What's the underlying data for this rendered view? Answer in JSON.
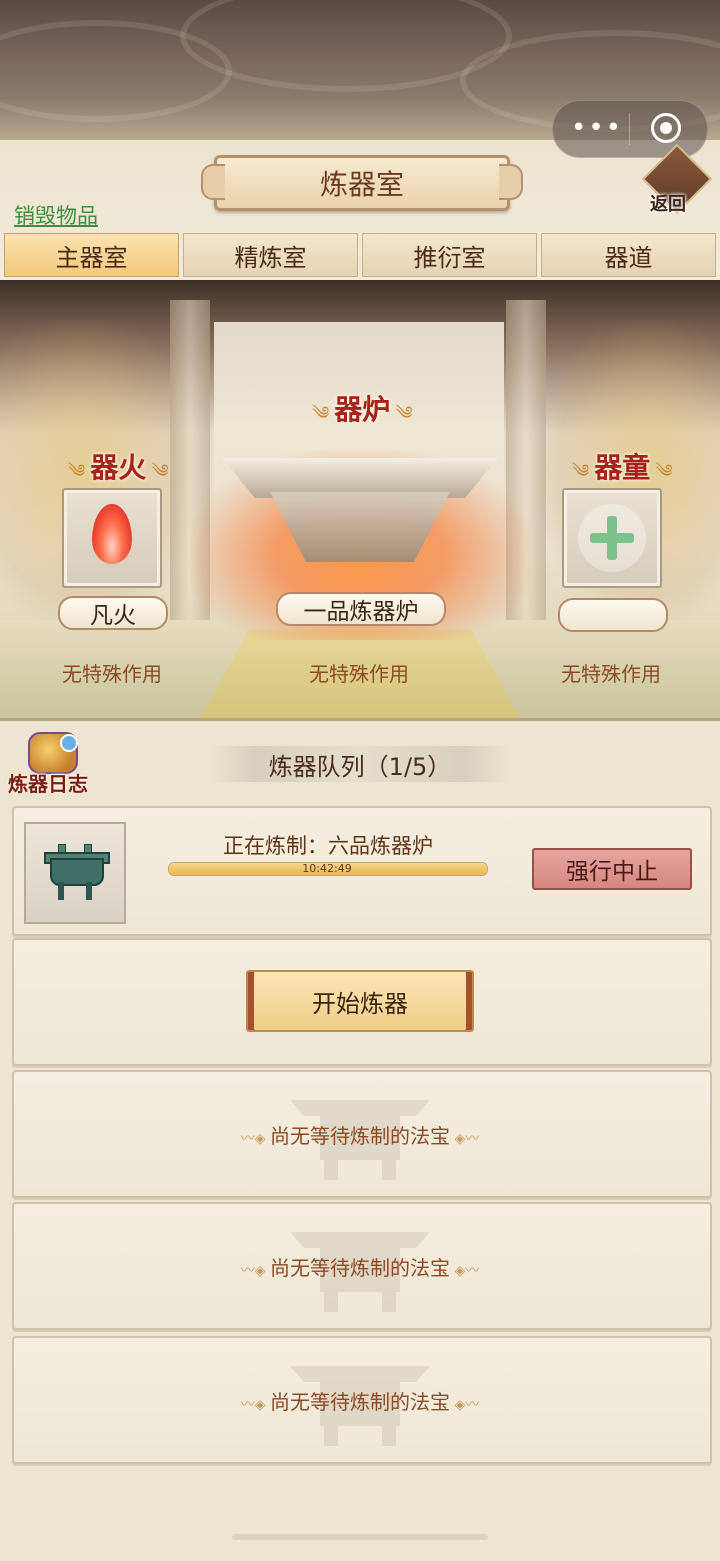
{
  "header": {
    "title": "炼器室",
    "back_label": "返回",
    "destroy_link": "销毁物品",
    "capsule_menu_icon": "more-dots-icon",
    "capsule_close_icon": "target-circle-icon"
  },
  "tabs": [
    {
      "label": "主器室",
      "active": true
    },
    {
      "label": "精炼室",
      "active": false
    },
    {
      "label": "推衍室",
      "active": false
    },
    {
      "label": "器道",
      "active": false
    }
  ],
  "hall": {
    "fire": {
      "title": "器火",
      "name": "凡火",
      "effect": "无特殊作用",
      "icon": "flame-icon"
    },
    "furnace": {
      "title": "器炉",
      "name": "一品炼器炉",
      "effect": "无特殊作用"
    },
    "boy": {
      "title": "器童",
      "name": "",
      "effect": "无特殊作用",
      "icon": "plus-icon"
    }
  },
  "queue": {
    "log_label": "炼器日志",
    "title": "炼器队列（1/5）",
    "current": {
      "status_text": "正在炼制：六品炼器炉",
      "timer": "10:42:49",
      "progress": 1.0,
      "stop_label": "强行中止",
      "item_icon": "bronze-cauldron-icon"
    },
    "start_label": "开始炼器",
    "empty_slots": [
      "尚无等待炼制的法宝",
      "尚无等待炼制的法宝",
      "尚无等待炼制的法宝"
    ]
  },
  "colors": {
    "accent_red": "#a5231b",
    "tab_active": "#f3c97c",
    "link_green": "#3c8f3c",
    "stop_button": "#d68680"
  }
}
